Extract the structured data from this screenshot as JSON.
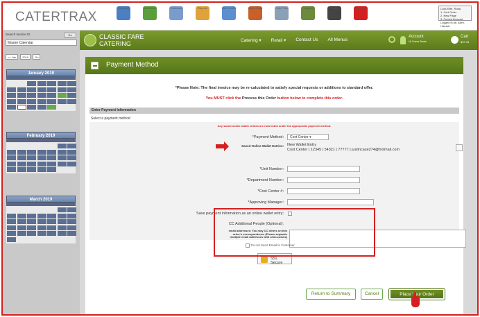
{
  "header": {
    "logo": "CATERTRAX",
    "icons": [
      {
        "name": "catering-icon",
        "label": "Catering",
        "color": "#4a7fc1"
      },
      {
        "name": "add-order-icon",
        "label": "Add Order",
        "color": "#5aa03a"
      },
      {
        "name": "calendar-icon",
        "label": "Calendar",
        "color": "#7a9ccd"
      },
      {
        "name": "reports-icon",
        "label": "Reports",
        "color": "#e0a23a"
      },
      {
        "name": "live-orders-icon",
        "label": "Live Orders",
        "color": "#5b8fd0"
      },
      {
        "name": "home-page-icon",
        "label": "Home Page",
        "color": "#c8602a"
      },
      {
        "name": "help-icon",
        "label": "Help Files",
        "color": "#8aa0b5"
      },
      {
        "name": "support-icon",
        "label": "Support",
        "color": "#6c8a3a"
      },
      {
        "name": "profile-icon",
        "label": "Profile",
        "color": "#444444"
      },
      {
        "name": "logout-icon",
        "label": "Log Off",
        "color": "#d42020"
      }
    ],
    "userbox": [
      "Lock Elite, Rosa",
      "1. Cert Order",
      "2. New Page",
      "3. Forced Account",
      "Logged in as: Allen, Hamish"
    ]
  },
  "sidebar": {
    "search_label": "Search Invoice ID",
    "go_label": "Go",
    "master_calendar": "Master Calendar",
    "selects": [
      "<< Jan",
      "2019",
      "Go"
    ],
    "calendars": [
      {
        "title": "January 2019"
      },
      {
        "title": "February 2019"
      },
      {
        "title": "March 2019"
      }
    ]
  },
  "nav": {
    "brand_line1": "CLASSIC FARE",
    "brand_line2": "CATERING",
    "items": [
      "Catering ▾",
      "Retail ▾",
      "Contact Us",
      "All Menus"
    ],
    "account": "Account",
    "account_sub": "Hi, Emma Bowie",
    "cart": "Cart",
    "cart_sub": "$37.45"
  },
  "page": {
    "title": "Payment Method",
    "note1": "*Please Note: The final invoice may be re-calculated to satisfy special requests or additions to standard offer.",
    "note2_a": "You MUST click the ",
    "note2_b": "Process this Order",
    "note2_c": " button below to complete this order.",
    "section_header": "Enter Payment Information",
    "select_method": "Select a payment method",
    "red_note": "Any saved online wallet entries are now listed under the appropriate payment method.",
    "payment_method_label": "*Payment Method:",
    "payment_method_value": "Cost Center ▾",
    "wallet_label": "Saved Online Wallet Entries:",
    "wallet_line1": "New Wallet Entry",
    "wallet_line2": "Cost Center | 12345 | 54321 | 77777 | justincase274@hotmail.com",
    "unit_label": "*Unit Number:",
    "dept_label": "*Department Number:",
    "cc_label": "*Cost Center #:",
    "approver_label": "*Approving Manager:",
    "save_wallet_label": "Save payment information as an online wallet entry:",
    "cc_people_label": "CC Additional People (Optional):",
    "cc_help": "email addresses: You may CC others on this order's correspondence (Please separate multiple email addresses with semi-colons)",
    "send_email": "Do not Send Email to Customer",
    "ssl": "SSL Secure",
    "return_btn": "Return to Summary",
    "cancel_btn": "Cancel",
    "place_btn": "Place Your Order"
  }
}
